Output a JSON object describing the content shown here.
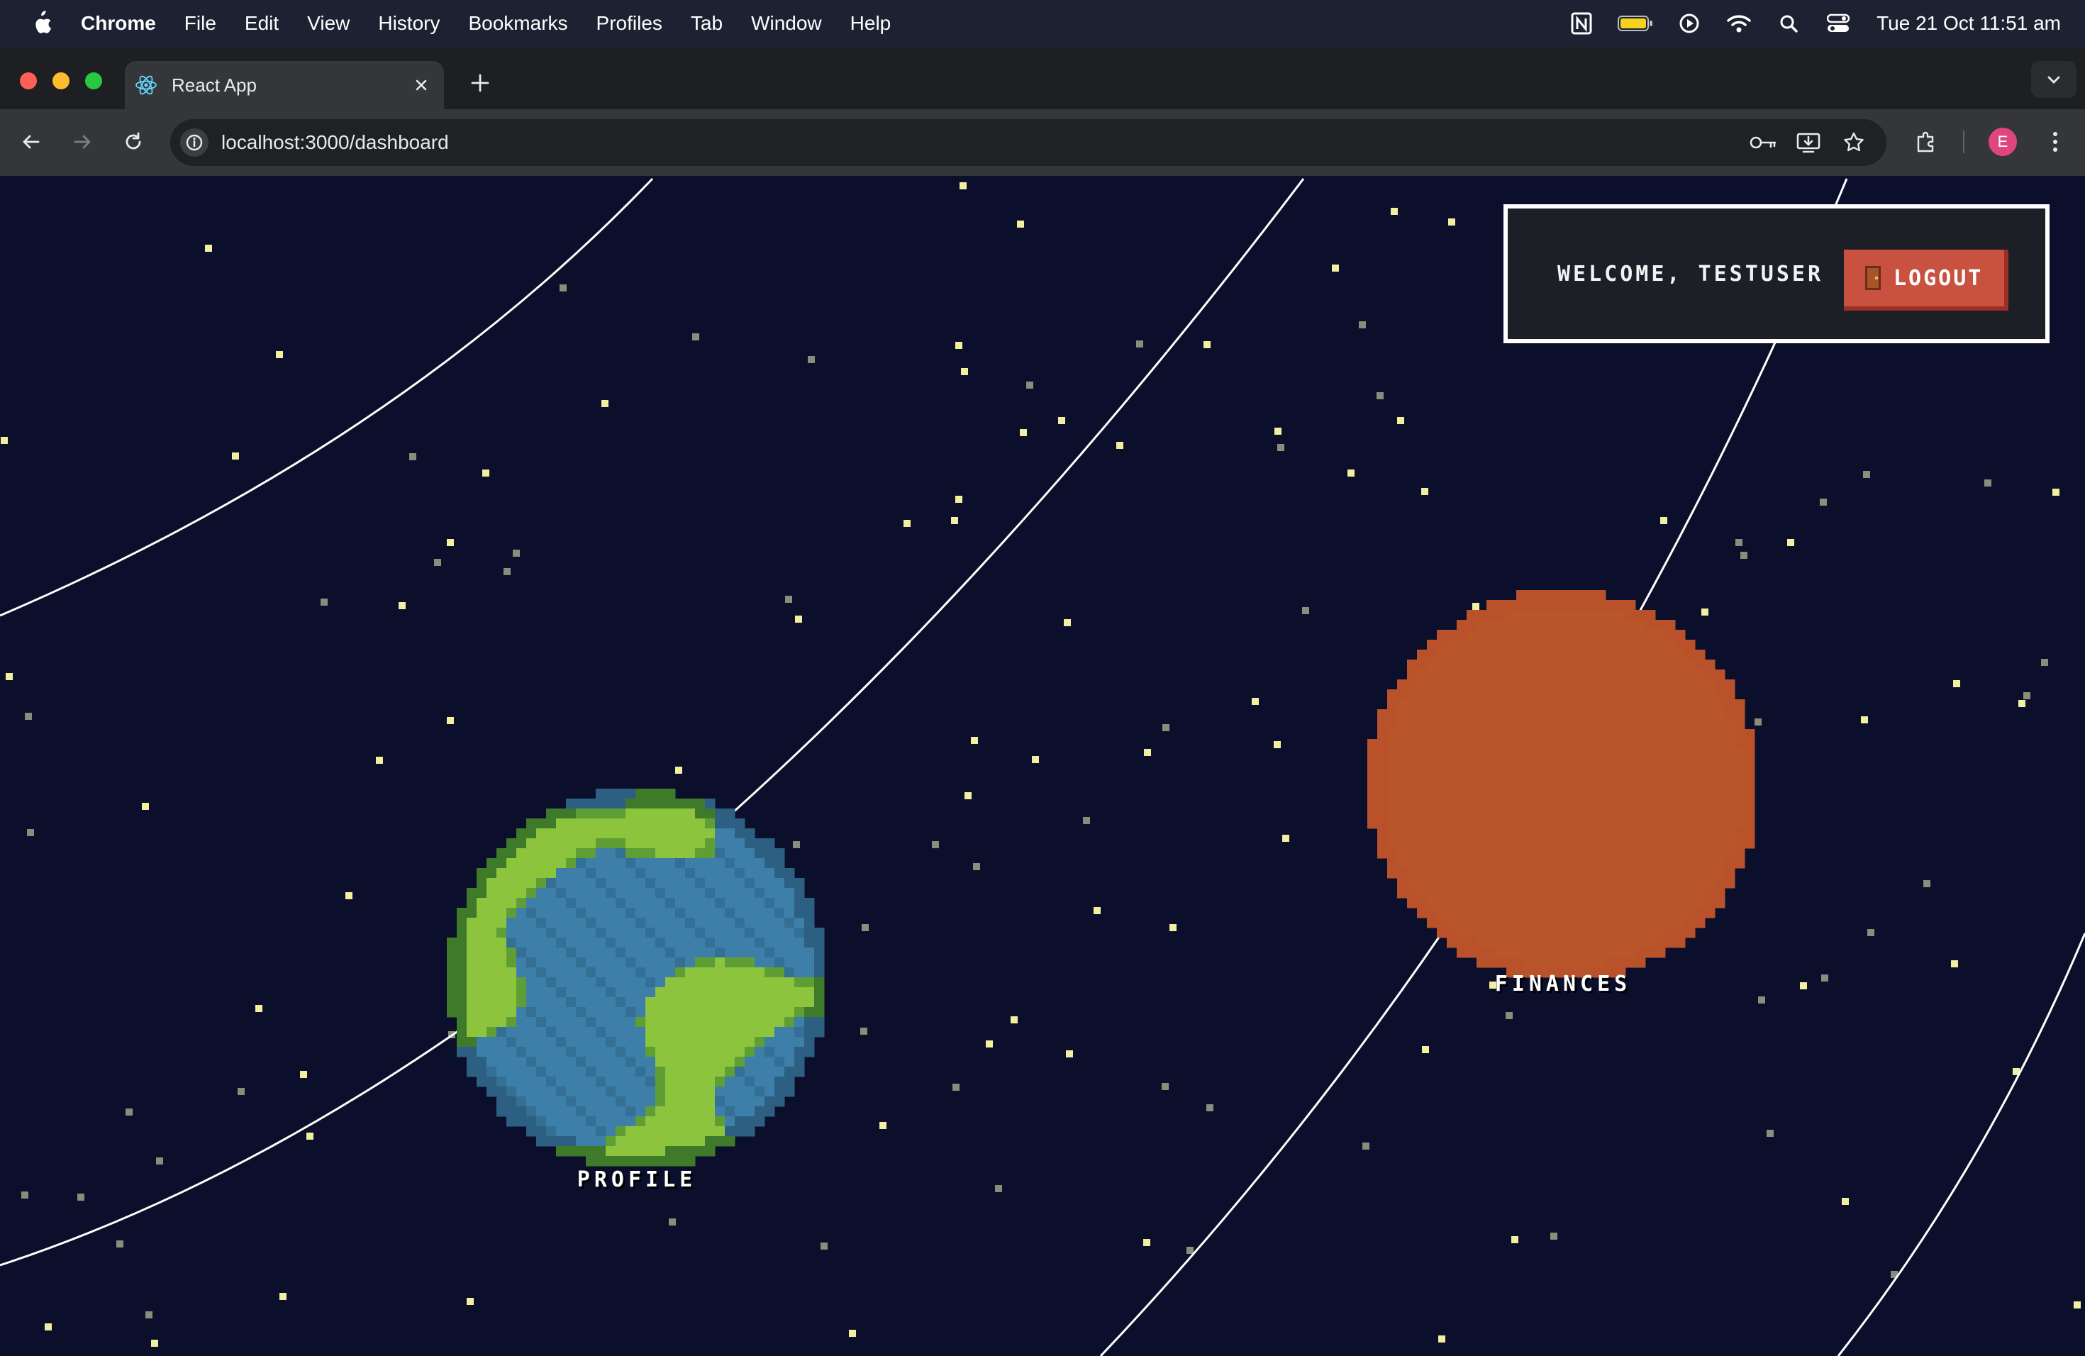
{
  "menubar": {
    "app_name": "Chrome",
    "items": [
      "File",
      "Edit",
      "View",
      "History",
      "Bookmarks",
      "Profiles",
      "Tab",
      "Window",
      "Help"
    ],
    "clock": "Tue 21 Oct  11:51 am",
    "status_icons": [
      "notion-icon",
      "battery-icon",
      "play-icon",
      "wifi-icon",
      "spotlight-search-icon",
      "control-center-icon"
    ]
  },
  "browser": {
    "tab_title": "React App",
    "url": "localhost:3000/dashboard",
    "profile_initial": "E",
    "colors": {
      "profile_avatar": "#e0457b"
    }
  },
  "page": {
    "welcome_text": "WELCOME, TESTUSER",
    "logout_label": "LOGOUT",
    "planets": {
      "profile": {
        "label": "PROFILE"
      },
      "finances": {
        "label": "FINANCES"
      }
    },
    "colors": {
      "space": "#0b0f2c",
      "logout_button": "#c9513f",
      "earth_ocean": "#3d7fa8",
      "earth_land": "#8cc43d",
      "jupiter_base": "#e07a2e",
      "jupiter_band": "#f2b350"
    }
  }
}
